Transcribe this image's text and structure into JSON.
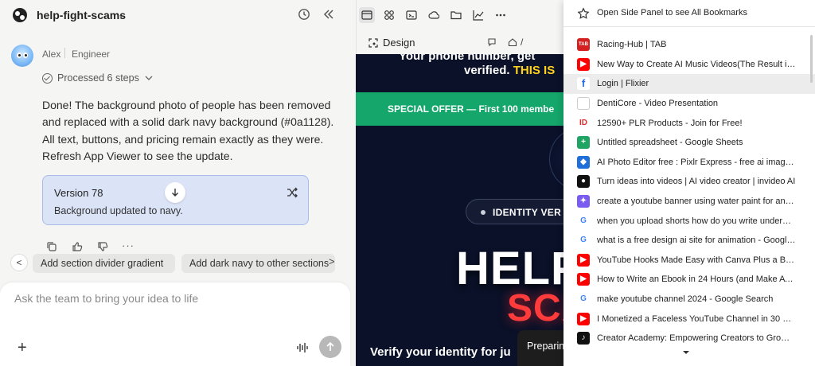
{
  "project": {
    "name": "help-fight-scams"
  },
  "author": {
    "name": "Alex",
    "role": "Engineer"
  },
  "processed": "Processed 6 steps",
  "message": "Done! The background photo of people has been removed and replaced with a solid dark navy background (#0a1128). All text, buttons, and pricing remain exactly as they were. Refresh App Viewer to see the update.",
  "version_card": {
    "title": "Version 78",
    "subtitle": "Background updated to navy."
  },
  "suggestions": [
    "Add section divider gradient",
    "Add dark navy to other sections"
  ],
  "composer": {
    "placeholder": "Ask the team to bring your idea to life"
  },
  "preview": {
    "tab": "Design",
    "path": "/",
    "site": {
      "top_line": "Your phone number, get",
      "verified_white": "verified.",
      "verified_yellow": "THIS IS",
      "offer": "SPECIAL OFFER — First 100 membe",
      "identity": "IDENTITY VER",
      "hero_line1": "HELP",
      "hero_line2": "SCA",
      "verify": "Verify your identity for ju"
    },
    "toast": "Preparin"
  },
  "bookmarks": {
    "header": "Open Side Panel to see All Bookmarks",
    "items": [
      {
        "label": "Racing-Hub | TAB",
        "icon": "tab-icon",
        "color": "#d32020",
        "glyph": "TAB"
      },
      {
        "label": "New Way to Create AI Music Videos(The Result is In...",
        "icon": "youtube-icon",
        "color": "#ff0000",
        "glyph": "▶"
      },
      {
        "label": "Login | Flixier",
        "icon": "flixier-icon",
        "color": "#ffffff",
        "glyph": "f"
      },
      {
        "label": "DentiCore - Video Presentation",
        "icon": "page-icon",
        "color": "#ffffff",
        "glyph": ""
      },
      {
        "label": "12590+ PLR Products - Join for Free!",
        "icon": "id-icon",
        "color": "#ffffff",
        "glyph": "ID"
      },
      {
        "label": "Untitled spreadsheet - Google Sheets",
        "icon": "sheets-icon",
        "color": "#1fa463",
        "glyph": "+"
      },
      {
        "label": "AI Photo Editor free : Pixlr Express - free ai image ed...",
        "icon": "pixlr-icon",
        "color": "#1e6fd9",
        "glyph": "◆"
      },
      {
        "label": "Turn ideas into videos | AI video creator | invideo AI",
        "icon": "invideo-icon",
        "color": "#111111",
        "glyph": "●"
      },
      {
        "label": "create a youtube banner using water paint for anim...",
        "icon": "copilot-icon",
        "color": "#7b5cf0",
        "glyph": "✦"
      },
      {
        "label": "when you upload shorts how do you write underne...",
        "icon": "google-icon",
        "color": "#ffffff",
        "glyph": "G"
      },
      {
        "label": "what is a free design ai site for animation - Google...",
        "icon": "google-icon",
        "color": "#ffffff",
        "glyph": "G"
      },
      {
        "label": "YouTube Hooks Made Easy with Canva Plus a Bonus...",
        "icon": "youtube-icon",
        "color": "#ff0000",
        "glyph": "▶"
      },
      {
        "label": "How to Write an Ebook in 24 Hours (and Make AT L...",
        "icon": "youtube-icon",
        "color": "#ff0000",
        "glyph": "▶"
      },
      {
        "label": "make youtube channel 2024 - Google Search",
        "icon": "google-icon",
        "color": "#ffffff",
        "glyph": "G"
      },
      {
        "label": "I Monetized a Faceless YouTube Channel in 30 Days...",
        "icon": "youtube-icon",
        "color": "#ff0000",
        "glyph": "▶"
      },
      {
        "label": "Creator Academy: Empowering Creators to Grow an...",
        "icon": "tiktok-icon",
        "color": "#111111",
        "glyph": "♪"
      }
    ]
  }
}
